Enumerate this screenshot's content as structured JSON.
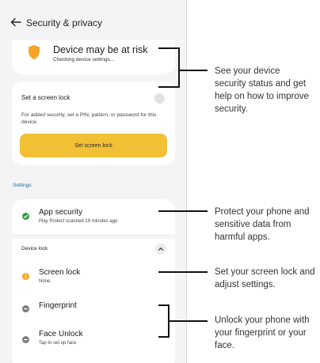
{
  "header": {
    "title": "Security & privacy"
  },
  "status_card": {
    "title": "Device may be at risk",
    "subtitle": "Checking device settings..."
  },
  "screen_lock_card": {
    "title": "Set a screen lock",
    "description": "For added security, set a PIN, pattern, or password for this device.",
    "button_label": "Set screen lock"
  },
  "settings_section": {
    "label": "Settings",
    "app_security": {
      "title": "App security",
      "subtitle": "Play Protect scanned 19 minutes ago"
    },
    "device_lock_label": "Device lock",
    "items": [
      {
        "title": "Screen lock",
        "subtitle": "None"
      },
      {
        "title": "Fingerprint",
        "subtitle": ""
      },
      {
        "title": "Face Unlock",
        "subtitle": "Tap to set up face"
      }
    ]
  },
  "callouts": [
    "See your device security status and get help on how to improve security.",
    "Protect your phone and sensitive data from harmful apps.",
    "Set your screen lock and adjust settings.",
    "Unlock your phone with your fingerprint or your face."
  ],
  "colors": {
    "accent_yellow": "#f2c035",
    "warning_orange": "#f5a623",
    "ok_green": "#2e9e44",
    "neutral_gray": "#7a7a7a",
    "link_blue": "#2a63a8"
  },
  "icons": [
    "back-arrow-icon",
    "shield-icon",
    "toggle-circle-icon",
    "check-circle-icon",
    "chevron-up-icon",
    "warning-circle-icon",
    "minus-circle-icon"
  ]
}
